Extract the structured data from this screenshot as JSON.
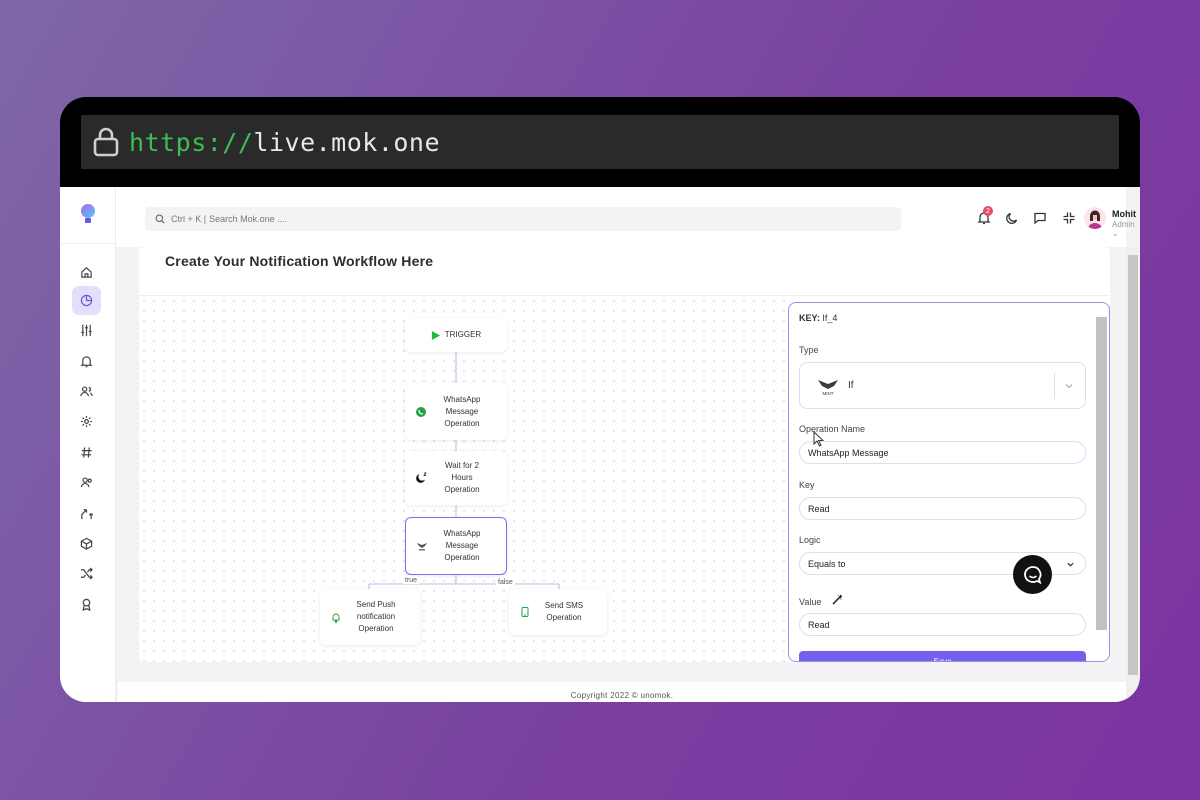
{
  "browser": {
    "url_scheme": "https://",
    "url_host": "live.mok.one"
  },
  "sidebar": {
    "items": [
      {
        "name": "home-icon"
      },
      {
        "name": "pie-chart-icon",
        "active": true
      },
      {
        "name": "sliders-icon"
      },
      {
        "name": "bell-icon"
      },
      {
        "name": "users-icon"
      },
      {
        "name": "gear-icon"
      },
      {
        "name": "hash-icon"
      },
      {
        "name": "contacts-icon"
      },
      {
        "name": "split-arrows-icon"
      },
      {
        "name": "cube-icon"
      },
      {
        "name": "shuffle-icon"
      },
      {
        "name": "award-icon"
      }
    ]
  },
  "topbar": {
    "search_shortcut": "Ctrl + K |",
    "search_placeholder": "Search Mok.one ....",
    "notification_count": "2",
    "user_name": "Mohit",
    "user_role": "Admin"
  },
  "page": {
    "title": "Create Your Notification Workflow Here"
  },
  "workflow": {
    "trigger_label": "TRIGGER",
    "nodes": {
      "whatsapp_1": "WhatsApp Message Operation",
      "wait": "Wait for 2 Hours Operation",
      "whatsapp_2": "WhatsApp Message Operation",
      "push": "Send Push notification Operation",
      "sms": "Send SMS Operation"
    },
    "edge_true": "true",
    "edge_false": "false"
  },
  "panel": {
    "key_label": "KEY:",
    "key_value": "If_4",
    "type_label": "Type",
    "type_value": "If",
    "type_logo_text": "MINT",
    "operation_name_label": "Operation Name",
    "operation_name_value": "WhatsApp Message",
    "key_field_label": "Key",
    "key_field_value": "Read",
    "logic_label": "Logic",
    "logic_value": "Equals to",
    "value_label": "Value",
    "value_value": "Read",
    "save_label": "Save"
  },
  "footer": {
    "copyright": "Copyright 2022 © unomok."
  },
  "colors": {
    "accent": "#7261ef",
    "active_bg": "#e4defa",
    "url_scheme": "#3bbf52",
    "badge": "#e84a6b"
  }
}
